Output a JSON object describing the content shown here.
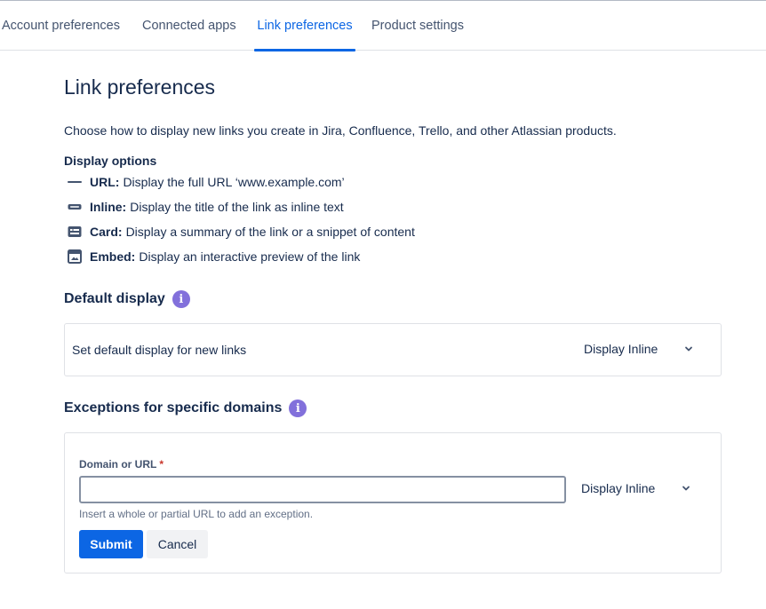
{
  "tabs": [
    {
      "label": "Account preferences",
      "active": false
    },
    {
      "label": "Connected apps",
      "active": false
    },
    {
      "label": "Link preferences",
      "active": true
    },
    {
      "label": "Product settings",
      "active": false
    }
  ],
  "page": {
    "title": "Link preferences",
    "intro": "Choose how to display new links you create in Jira, Confluence, Trello, and other Atlassian products."
  },
  "display_options": {
    "heading": "Display options",
    "items": [
      {
        "icon": "url-line-icon",
        "name": "URL:",
        "description": "Display the full URL ‘www.example.com’"
      },
      {
        "icon": "inline-link-icon",
        "name": "Inline:",
        "description": "Display the title of the link as inline text"
      },
      {
        "icon": "card-icon",
        "name": "Card:",
        "description": "Display a summary of the link or a snippet of content"
      },
      {
        "icon": "embed-icon",
        "name": "Embed:",
        "description": "Display an interactive preview of the link"
      }
    ]
  },
  "default_display": {
    "title": "Default display",
    "label": "Set default display for new links",
    "selected": "Display Inline"
  },
  "exceptions": {
    "title": "Exceptions for specific domains",
    "field_label": "Domain or URL",
    "required_marker": "*",
    "input_value": "",
    "selected": "Display Inline",
    "help_text": "Insert a whole or partial URL to add an exception.",
    "submit_label": "Submit",
    "cancel_label": "Cancel"
  },
  "colors": {
    "accent": "#0C66E4",
    "info": "#8270DB",
    "required": "#C9372C",
    "text": "#172B4D"
  }
}
